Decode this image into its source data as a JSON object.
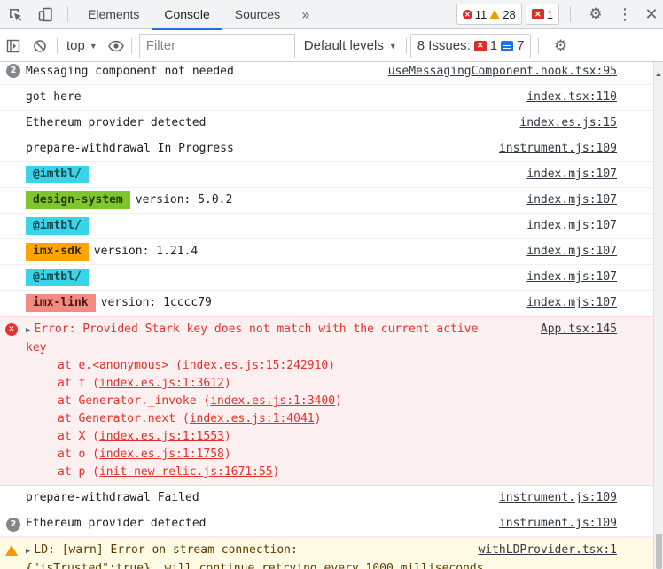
{
  "tabbar": {
    "tabs": [
      {
        "label": "Elements"
      },
      {
        "label": "Console",
        "active": true
      },
      {
        "label": "Sources"
      }
    ],
    "more_label": "»",
    "errors_count": "11",
    "warnings_count": "28",
    "issues_red_count": "1"
  },
  "toolbar": {
    "context": "top",
    "filter_placeholder": "Filter",
    "levels_label": "Default levels",
    "issues_label": "8 Issues:",
    "issues_red": "1",
    "issues_blue": "7"
  },
  "colors": {
    "accent": "#1a73e8",
    "error": "#e8302b",
    "warning": "#f29900",
    "tag_cyan": "#3ad4e8",
    "tag_green": "#7fc62d",
    "tag_orange": "#ffa400",
    "tag_salmon": "#f28b82"
  },
  "console": {
    "rows": [
      {
        "count": "2",
        "text": "Messaging component not needed",
        "src": "useMessagingComponent.hook.tsx:95"
      },
      {
        "text": "got here",
        "src": "index.tsx:110"
      },
      {
        "text": "Ethereum provider detected",
        "src": "index.es.js:15"
      },
      {
        "text": "prepare-withdrawal In Progress",
        "src": "instrument.js:109"
      },
      {
        "tag": "@imtbl/",
        "src": "index.mjs:107"
      },
      {
        "tag": "design-system",
        "text": "version: 5.0.2",
        "src": "index.mjs:107"
      },
      {
        "tag": "@imtbl/",
        "src": "index.mjs:107"
      },
      {
        "tag": "imx-sdk",
        "text": "version: 1.21.4",
        "src": "index.mjs:107"
      },
      {
        "tag": "@imtbl/",
        "src": "index.mjs:107"
      },
      {
        "tag": "imx-link",
        "text": "version: 1cccc79",
        "src": "index.mjs:107"
      }
    ],
    "error": {
      "message": "Error: Provided Stark key does not match with the current active key",
      "src": "App.tsx:145",
      "stack": [
        {
          "prefix": "at e.<anonymous> (",
          "link": "index.es.js:15:242910",
          "suffix": ")"
        },
        {
          "prefix": "at f (",
          "link": "index.es.js:1:3612",
          "suffix": ")"
        },
        {
          "prefix": "at Generator._invoke (",
          "link": "index.es.js:1:3400",
          "suffix": ")"
        },
        {
          "prefix": "at Generator.next (",
          "link": "index.es.js:1:4041",
          "suffix": ")"
        },
        {
          "prefix": "at X (",
          "link": "index.es.js:1:1553",
          "suffix": ")"
        },
        {
          "prefix": "at o (",
          "link": "index.es.js:1:1758",
          "suffix": ")"
        },
        {
          "prefix": "at p (",
          "link": "init-new-relic.js:1671:55",
          "suffix": ")"
        }
      ]
    },
    "after_rows": [
      {
        "text": "prepare-withdrawal Failed",
        "src": "instrument.js:109"
      },
      {
        "count": "2",
        "text": "Ethereum provider detected",
        "src": "instrument.js:109"
      }
    ],
    "warning": {
      "line1": "LD: [warn] Error on stream connection:",
      "line2": "{\"isTrusted\":true}, will continue retrying every 1000 milliseconds.",
      "src": "withLDProvider.tsx:1"
    }
  }
}
